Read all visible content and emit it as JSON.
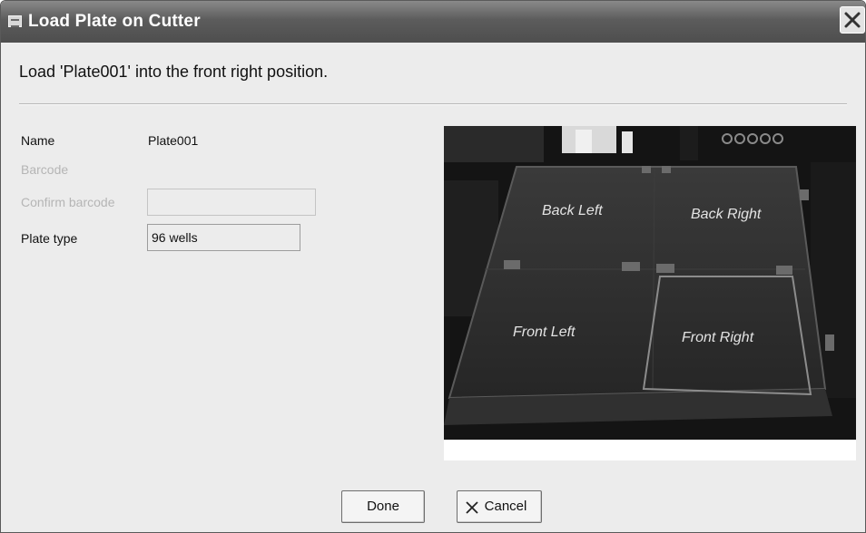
{
  "window": {
    "title": "Load Plate on Cutter"
  },
  "instruction": "Load 'Plate001' into the front right position.",
  "form": {
    "name_label": "Name",
    "name_value": "Plate001",
    "barcode_label": "Barcode",
    "confirm_barcode_label": "Confirm barcode",
    "confirm_barcode_value": "",
    "plate_type_label": "Plate type",
    "plate_type_value": "96 wells"
  },
  "photo": {
    "positions": {
      "back_left": "Back Left",
      "back_right": "Back Right",
      "front_left": "Front Left",
      "front_right": "Front Right"
    },
    "highlighted": "front_right"
  },
  "buttons": {
    "done_label": "Done",
    "cancel_label": "Cancel"
  },
  "icons": {
    "title": "window-icon",
    "close": "close-icon",
    "cancel": "x-icon"
  }
}
